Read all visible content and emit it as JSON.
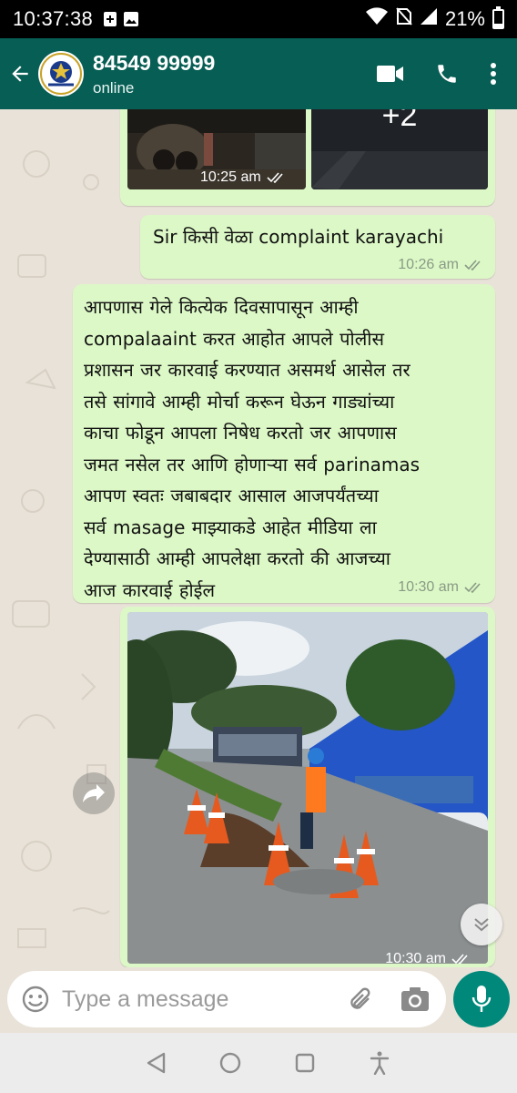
{
  "status_bar": {
    "time": "10:37:38",
    "battery_text": "21%",
    "battery_level": 0.21,
    "icons": [
      "plus-notification-icon",
      "image-notification-icon",
      "wifi-icon",
      "no-sim-icon",
      "signal-icon",
      "battery-icon"
    ]
  },
  "header": {
    "contact_name": "84549 99999",
    "contact_status": "online",
    "icons": [
      "back-arrow-icon",
      "video-call-icon",
      "voice-call-icon",
      "more-vert-icon"
    ]
  },
  "messages": [
    {
      "type": "image_group",
      "more_count": "+2",
      "time": "10:25 am",
      "ticks": "read"
    },
    {
      "type": "text",
      "text": "Sir किसी वेळा complaint karayachi",
      "time": "10:26 am",
      "ticks": "read"
    },
    {
      "type": "text",
      "lines": [
        "आपणास गेले कित्येक दिवसापासून आम्ही",
        "compalaaint करत आहोत आपले पोलीस",
        "प्रशासन जर कारवाई करण्यात असमर्थ आसेल तर",
        "तसे सांगावे आम्ही मोर्चा करून घेऊन गाड्यांच्या",
        "काचा फोडून आपला निषेध करतो जर आपणास",
        "जमत नसेल तर आणि होणाऱ्या सर्व parinamas",
        "आपण स्वतः जबाबदार आसाल आजपर्यंतच्या",
        "सर्व masage माझ्याकडे आहेत मीडिया ला",
        "देण्यासाठी आम्ही आपलेक्षा करतो की आजच्या",
        "आज कारवाई होईल"
      ],
      "time": "10:30 am",
      "ticks": "read"
    },
    {
      "type": "image",
      "time": "10:30 am",
      "ticks": "read"
    }
  ],
  "composer": {
    "placeholder": "Type a message",
    "icons": [
      "emoji-icon",
      "attach-icon",
      "camera-icon",
      "mic-icon"
    ]
  },
  "nav": {
    "icons": [
      "back-triangle-icon",
      "home-circle-icon",
      "recents-square-icon",
      "accessibility-icon"
    ]
  },
  "colors": {
    "header": "#075e54",
    "bubble_outgoing": "#dcf8c6",
    "chat_background": "#e9e2d8",
    "mic_button": "#00897b"
  }
}
